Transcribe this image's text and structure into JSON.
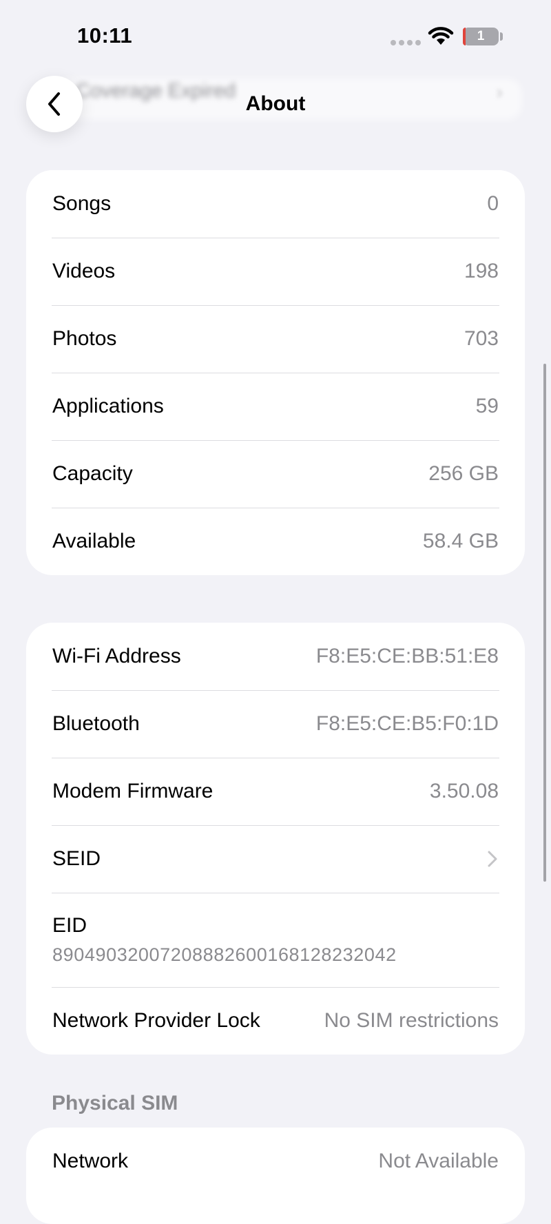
{
  "status_bar": {
    "time": "10:11",
    "battery_level": "1",
    "battery_fill_fraction": 0.01,
    "battery_fill_color": "#e0443b"
  },
  "nav": {
    "title": "About",
    "background_row_text": "Coverage Expired",
    "back_icon": "chevron-left-icon"
  },
  "media_group": [
    {
      "label": "Songs",
      "value": "0"
    },
    {
      "label": "Videos",
      "value": "198"
    },
    {
      "label": "Photos",
      "value": "703"
    },
    {
      "label": "Applications",
      "value": "59"
    },
    {
      "label": "Capacity",
      "value": "256 GB"
    },
    {
      "label": "Available",
      "value": "58.4 GB"
    }
  ],
  "network_group": {
    "wifi": {
      "label": "Wi-Fi Address",
      "value": "F8:E5:CE:BB:51:E8"
    },
    "bluetooth": {
      "label": "Bluetooth",
      "value": "F8:E5:CE:B5:F0:1D"
    },
    "modem": {
      "label": "Modem Firmware",
      "value": "3.50.08"
    },
    "seid": {
      "label": "SEID",
      "icon": "chevron-right-icon"
    },
    "eid": {
      "label": "EID",
      "value": "89049032007208882600168128232042"
    },
    "lock": {
      "label": "Network Provider Lock",
      "value": "No SIM restrictions"
    }
  },
  "sim_section": {
    "header": "Physical SIM",
    "network": {
      "label": "Network",
      "value": "Not Available"
    }
  },
  "colors": {
    "background": "#f2f2f7",
    "card": "#ffffff",
    "secondary_text": "#8a8a8e",
    "separator": "#dcdce0"
  }
}
